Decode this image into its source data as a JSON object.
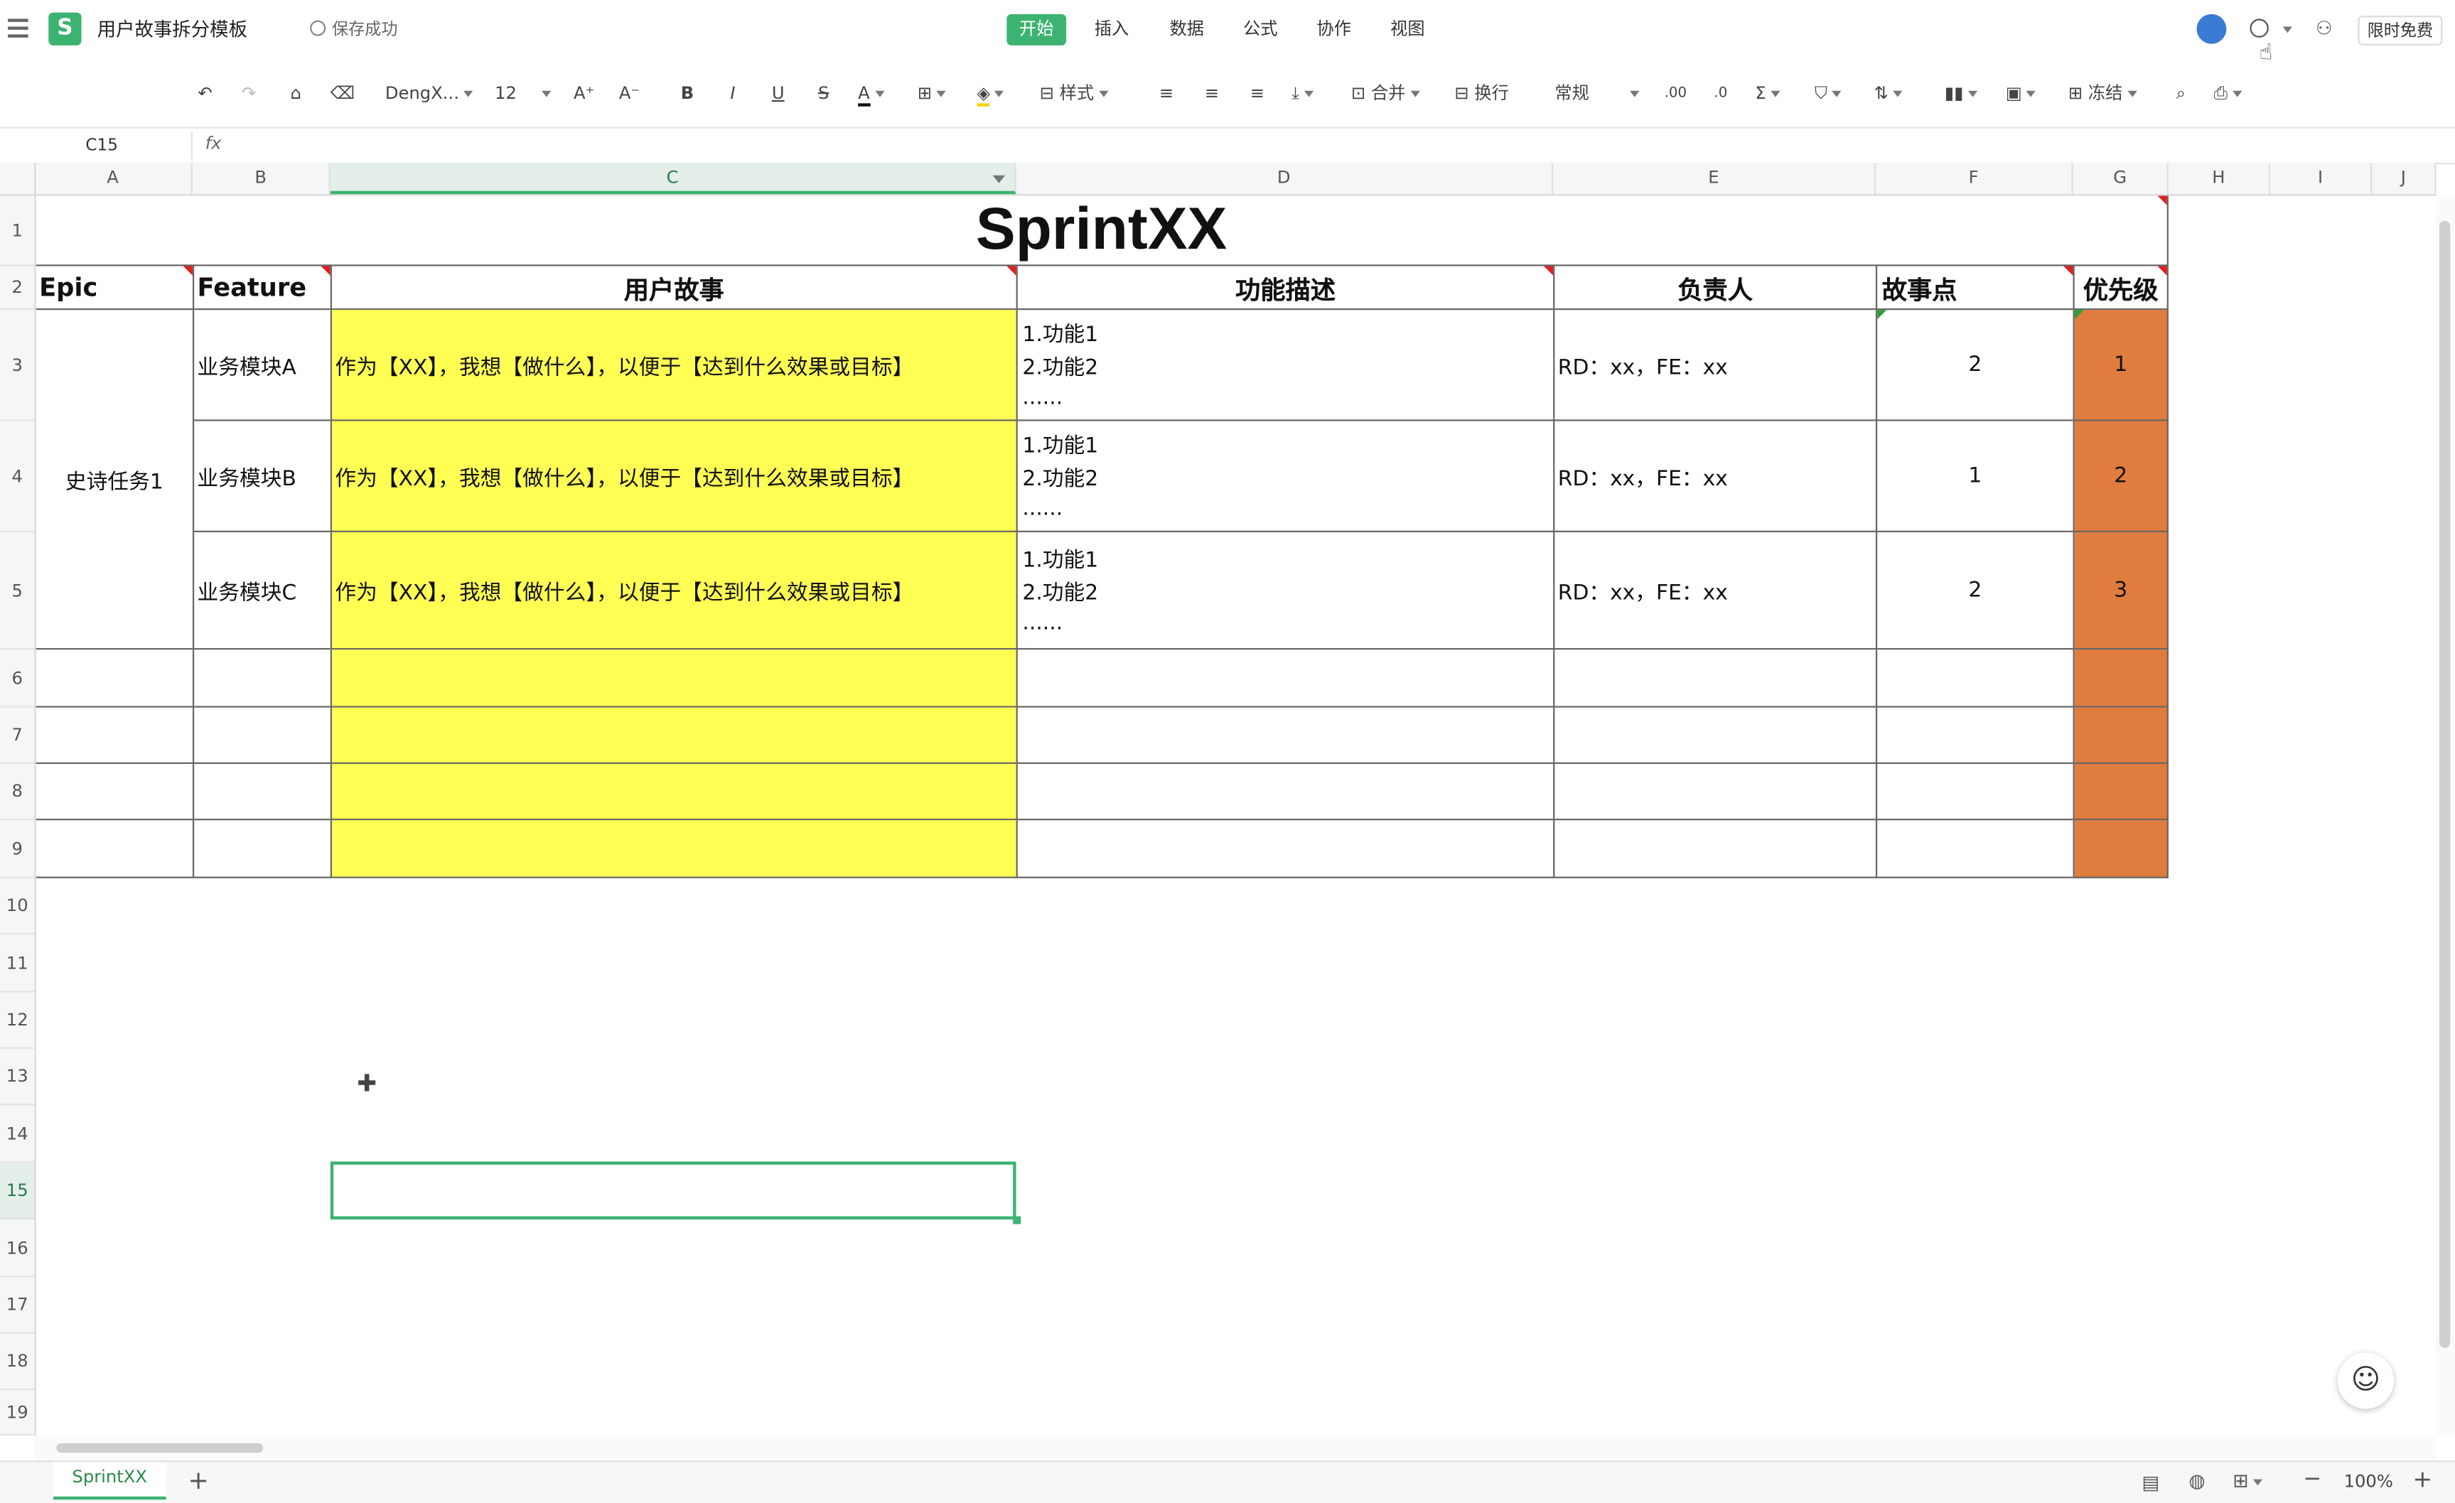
{
  "app": {
    "doc_title": "用户故事拆分模板",
    "save_status": "保存成功",
    "free_label": "限时免费"
  },
  "menu_tabs": [
    "开始",
    "插入",
    "数据",
    "公式",
    "协作",
    "视图"
  ],
  "toolbar": {
    "font_name": "DengX...",
    "font_size": "12",
    "style_label": "样式",
    "merge_label": "合并",
    "wrap_label": "换行",
    "number_format": "常规",
    "freeze_label": "冻结"
  },
  "formula_bar": {
    "cell_ref": "C15",
    "fx": "fx",
    "value": ""
  },
  "columns": [
    "A",
    "B",
    "C",
    "D",
    "E",
    "F",
    "G",
    "H",
    "I",
    "J"
  ],
  "rows": [
    "1",
    "2",
    "3",
    "4",
    "5",
    "6",
    "7",
    "8",
    "9",
    "10",
    "11",
    "12",
    "13",
    "14",
    "15",
    "16",
    "17",
    "18",
    "19"
  ],
  "sheet": {
    "title": "SprintXX",
    "headers": {
      "epic": "Epic",
      "feature": "Feature",
      "story": "用户故事",
      "desc": "功能描述",
      "owner": "负责人",
      "points": "故事点",
      "priority": "优先级"
    },
    "epic_value": "史诗任务1",
    "data_rows": [
      {
        "feature": "业务模块A",
        "story": "作为【XX】，我想【做什么】，以便于【达到什么效果或目标】",
        "desc1": "1.功能1",
        "desc2": "2.功能2",
        "desc3": "......",
        "owner": "RD：xx，FE：xx",
        "points": "2",
        "priority": "1"
      },
      {
        "feature": "业务模块B",
        "story": "作为【XX】，我想【做什么】，以便于【达到什么效果或目标】",
        "desc1": "1.功能1",
        "desc2": "2.功能2",
        "desc3": "......",
        "owner": "RD：xx，FE：xx",
        "points": "1",
        "priority": "2"
      },
      {
        "feature": "业务模块C",
        "story": "作为【XX】，我想【做什么】，以便于【达到什么效果或目标】",
        "desc1": "1.功能1",
        "desc2": "2.功能2",
        "desc3": "......",
        "owner": "RD：xx，FE：xx",
        "points": "2",
        "priority": "3"
      }
    ]
  },
  "sheet_tabs": [
    "SprintXX"
  ],
  "status": {
    "zoom": "100%"
  },
  "colors": {
    "accent": "#3cb371",
    "story_fill": "#ffff54",
    "priority_fill": "#e07c3e"
  }
}
